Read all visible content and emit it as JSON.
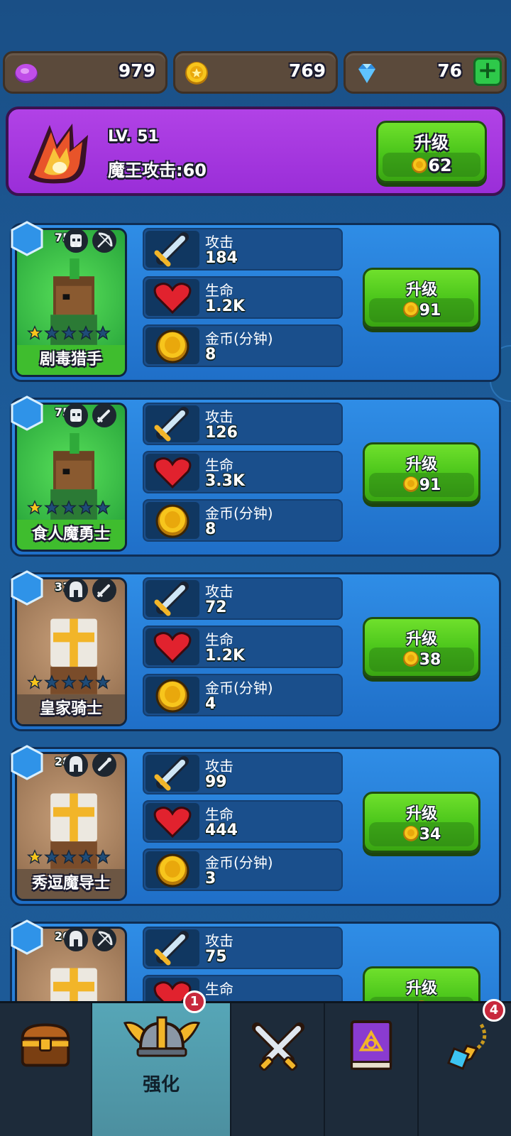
{
  "currency": {
    "orb": "979",
    "gold": "769",
    "gem": "76",
    "add_label": "+"
  },
  "boss": {
    "level": "LV. 51",
    "attack": "魔王攻击:60",
    "upgrade_label": "升级",
    "upgrade_cost": "62"
  },
  "stats_labels": {
    "attack": "攻击",
    "life": "生命",
    "gold_per_min": "金币(分钟)"
  },
  "heroes": [
    {
      "name": "剧毒猎手",
      "level": "75",
      "attack": "184",
      "life": "1.2K",
      "gold": "8",
      "upgrade_label": "升级",
      "cost": "91",
      "stars": 1,
      "max_stars": 5,
      "rarity": "green",
      "classes": [
        "orc-icon",
        "bow-icon"
      ]
    },
    {
      "name": "食人魔勇士",
      "level": "75",
      "attack": "126",
      "life": "3.3K",
      "gold": "8",
      "upgrade_label": "升级",
      "cost": "91",
      "stars": 1,
      "max_stars": 5,
      "rarity": "green",
      "classes": [
        "orc-icon",
        "sword-icon"
      ]
    },
    {
      "name": "皇家骑士",
      "level": "31",
      "attack": "72",
      "life": "1.2K",
      "gold": "4",
      "upgrade_label": "升级",
      "cost": "38",
      "stars": 1,
      "max_stars": 5,
      "rarity": "brown",
      "classes": [
        "helmet-icon",
        "sword-icon"
      ]
    },
    {
      "name": "秀逗魔导士",
      "level": "28",
      "attack": "99",
      "life": "444",
      "gold": "3",
      "upgrade_label": "升级",
      "cost": "34",
      "stars": 1,
      "max_stars": 5,
      "rarity": "brown",
      "classes": [
        "helmet-icon",
        "wand-icon"
      ]
    },
    {
      "name": "",
      "level": "26",
      "attack": "75",
      "life": "",
      "gold": "",
      "upgrade_label": "升级",
      "cost": "",
      "stars": 1,
      "max_stars": 5,
      "rarity": "brown",
      "classes": [
        "helmet-icon",
        "bow-icon"
      ]
    }
  ],
  "nav": {
    "tabs": [
      {
        "icon": "treasure-chest-icon",
        "label": ""
      },
      {
        "icon": "winged-helmet-icon",
        "label": "强化",
        "badge": "1"
      },
      {
        "icon": "crossed-swords-icon",
        "label": ""
      },
      {
        "icon": "spellbook-icon",
        "label": ""
      },
      {
        "icon": "amulet-icon",
        "label": "",
        "badge": "4"
      }
    ]
  },
  "colors": {
    "accent_purple": "#a43ae0",
    "button_green": "#49c41a",
    "card_blue": "#2a80da",
    "badge_red": "#c8283c"
  }
}
